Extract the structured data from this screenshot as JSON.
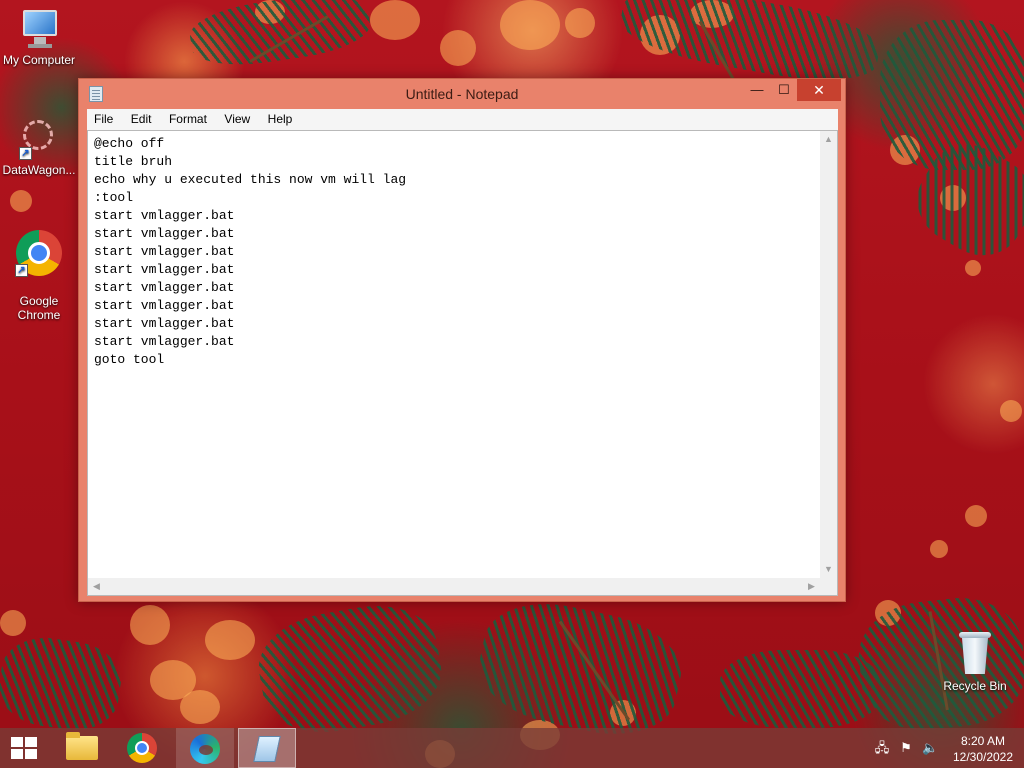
{
  "desktop": {
    "icons": [
      {
        "label": "My Computer",
        "icon": "computer-icon"
      },
      {
        "label": "DataWagon...",
        "icon": "datawagon-icon"
      },
      {
        "label": "Google\nChrome",
        "icon": "chrome-icon"
      },
      {
        "label": "Recycle Bin",
        "icon": "recycle-bin-icon"
      }
    ]
  },
  "window": {
    "title": "Untitled - Notepad",
    "buttons": {
      "minimize": "—",
      "maximize": "☐",
      "close": "✕"
    },
    "menu": [
      "File",
      "Edit",
      "Format",
      "View",
      "Help"
    ],
    "content": "@echo off\ntitle bruh\necho why u executed this now vm will lag\n:tool\nstart vmlagger.bat\nstart vmlagger.bat\nstart vmlagger.bat\nstart vmlagger.bat\nstart vmlagger.bat\nstart vmlagger.bat\nstart vmlagger.bat\nstart vmlagger.bat\ngoto tool"
  },
  "taskbar": {
    "items": [
      "start-button",
      "file-explorer",
      "google-chrome",
      "microsoft-edge",
      "notepad"
    ],
    "tray": {
      "time": "8:20 AM",
      "date": "12/30/2022"
    }
  },
  "colors": {
    "window_frame": "#e9826b",
    "close_button": "#c7412f",
    "desktop_red": "#b3151f"
  }
}
